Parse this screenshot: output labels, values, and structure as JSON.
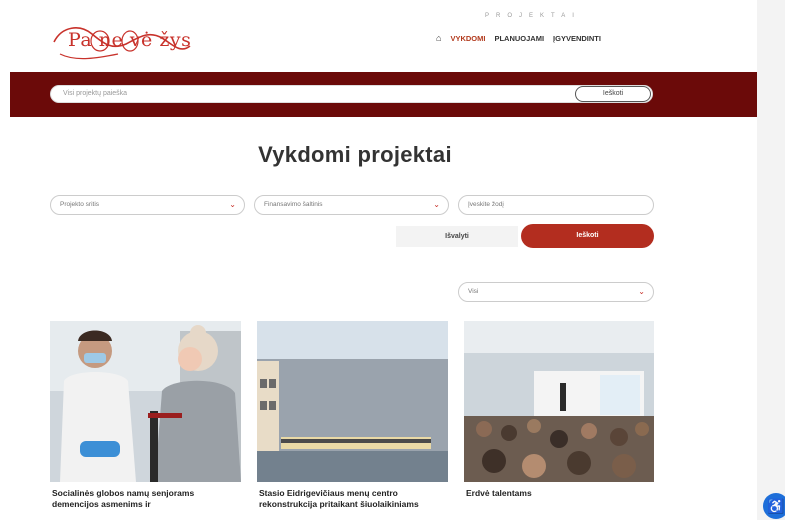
{
  "header": {
    "logo_text": "Pa ne vė žys",
    "nav_eyebrow": "PROJEKTAI",
    "nav": [
      {
        "label": "VYKDOMI",
        "active": true
      },
      {
        "label": "PLANUOJAMI",
        "active": false
      },
      {
        "label": "ĮGYVENDINTI",
        "active": false
      }
    ]
  },
  "search": {
    "placeholder": "Visi projektų paieška",
    "button_label": "Ieškoti"
  },
  "main": {
    "title": "Vykdomi projektai",
    "filters": [
      {
        "placeholder": "Projekto sritis"
      },
      {
        "placeholder": "Finansavimo šaltinis"
      },
      {
        "placeholder": "Įveskite žodį"
      }
    ],
    "clear_label": "Išvalyti",
    "submit_label": "Ieškoti",
    "sort": {
      "value": "Visi"
    }
  },
  "cards": [
    {
      "title": "Socialinės globos namų senjorams demencijos asmenims ir"
    },
    {
      "title": "Stasio Eidrigevičiaus menų centro rekonstrukcija pritaikant šiuolaikiniams"
    },
    {
      "title": "Erdvė talentams"
    }
  ],
  "colors": {
    "brand": "#6b0a09",
    "accent": "#b32d1f",
    "logo": "#c8322b",
    "fab": "#1e6fd9"
  },
  "icons": {
    "home": "home-icon",
    "chevron": "chevron-down-icon",
    "accessibility": "accessibility-icon"
  }
}
